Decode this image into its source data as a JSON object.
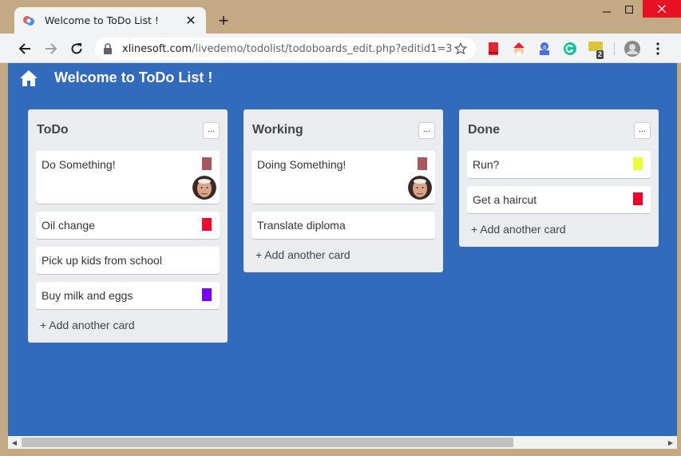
{
  "browser": {
    "tab_title": "Welcome to ToDo List !",
    "new_tab_label": "+",
    "url_host": "xlinesoft.com",
    "url_path": "/livedemo/todolist/todoboards_edit.php?editid1=3",
    "extension_badge": "2"
  },
  "app": {
    "title": "Welcome to ToDo List !"
  },
  "colors": {
    "page_bg": "#336bbc",
    "board_bg": "#ebecf0",
    "label_mauve": "#a75760",
    "label_red": "#ff0030",
    "label_purple": "#7a00ff",
    "label_yellow": "#eaff3a",
    "label_crimson": "#f2002a"
  },
  "boards": [
    {
      "name": "ToDo",
      "menu_label": "...",
      "cards": [
        {
          "title": "Do Something!",
          "label_color": "#a75760",
          "has_avatar": true
        },
        {
          "title": "Oil change",
          "label_color": "#ff0030",
          "has_avatar": false
        },
        {
          "title": "Pick up kids from school",
          "label_color": null,
          "has_avatar": false
        },
        {
          "title": "Buy milk and eggs",
          "label_color": "#7a00ff",
          "has_avatar": false
        }
      ],
      "add_label": "+ Add another card"
    },
    {
      "name": "Working",
      "menu_label": "...",
      "cards": [
        {
          "title": "Doing Something!",
          "label_color": "#a75760",
          "has_avatar": true
        },
        {
          "title": "Translate diploma",
          "label_color": null,
          "has_avatar": false
        }
      ],
      "add_label": "+ Add another card"
    },
    {
      "name": "Done",
      "menu_label": "...",
      "cards": [
        {
          "title": "Run?",
          "label_color": "#eaff3a",
          "has_avatar": false
        },
        {
          "title": "Get a haircut",
          "label_color": "#f2002a",
          "has_avatar": false
        }
      ],
      "add_label": "+ Add another card"
    }
  ]
}
